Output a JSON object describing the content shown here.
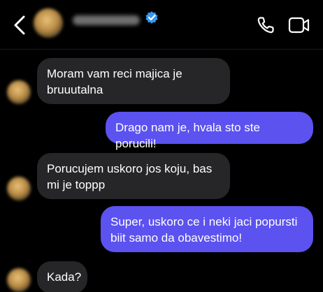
{
  "header": {
    "contact_name": "kontakt",
    "verified": true,
    "accent_color": "#3897f0"
  },
  "icons": {
    "back": "chevron-left-icon",
    "verified": "verified-badge-icon",
    "call": "phone-icon",
    "video": "video-camera-icon"
  },
  "colors": {
    "background": "#000000",
    "received_bubble": "#262629",
    "sent_bubble": "#5b52f0"
  },
  "messages": [
    {
      "direction": "received",
      "text": "Moram vam reci majica je bruuutalna"
    },
    {
      "direction": "sent",
      "text": "Drago nam je, hvala sto ste porucili!"
    },
    {
      "direction": "received",
      "text": "Porucujem uskoro jos koju, bas mi je toppp"
    },
    {
      "direction": "sent",
      "text": "Super, uskoro ce i neki jaci popursti biit samo da obavestimo!"
    },
    {
      "direction": "received",
      "text": "Kada?"
    }
  ]
}
